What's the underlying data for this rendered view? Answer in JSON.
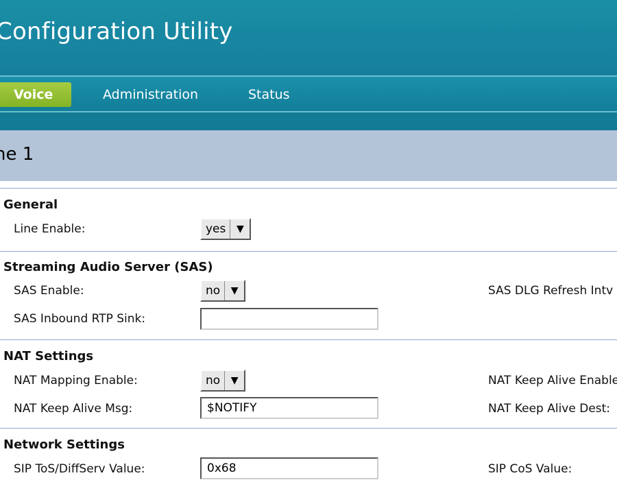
{
  "header": {
    "title": "Configuration Utility"
  },
  "nav": {
    "tabs": [
      {
        "label": "Voice",
        "active": true
      },
      {
        "label": "Administration",
        "active": false
      },
      {
        "label": "Status",
        "active": false
      }
    ]
  },
  "page": {
    "heading": "ne 1"
  },
  "sections": {
    "general": {
      "title": "General",
      "line_enable": {
        "label": "Line Enable:",
        "value": "yes"
      }
    },
    "sas": {
      "title": "Streaming Audio Server (SAS)",
      "sas_enable": {
        "label": "SAS Enable:",
        "value": "no"
      },
      "sas_dlg_refresh": {
        "label": "SAS DLG Refresh Intv"
      },
      "sas_inbound_rtp_sink": {
        "label": "SAS Inbound RTP Sink:",
        "value": ""
      }
    },
    "nat": {
      "title": "NAT Settings",
      "nat_mapping_enable": {
        "label": "NAT Mapping Enable:",
        "value": "no"
      },
      "nat_keep_alive_enable": {
        "label": "NAT Keep Alive Enable"
      },
      "nat_keep_alive_msg": {
        "label": "NAT Keep Alive Msg:",
        "value": "$NOTIFY"
      },
      "nat_keep_alive_dest": {
        "label": "NAT Keep Alive Dest:"
      }
    },
    "network": {
      "title": "Network Settings",
      "sip_tos": {
        "label": "SIP ToS/DiffServ Value:",
        "value": "0x68"
      },
      "sip_cos": {
        "label": "SIP CoS Value:"
      }
    }
  },
  "colors": {
    "header": "#1782a0",
    "active_tab": "#94bf2f",
    "heading_bar": "#b4c4d8",
    "section_rule": "#9da4d6"
  },
  "icons": {
    "dropdown": "triangle-down"
  }
}
